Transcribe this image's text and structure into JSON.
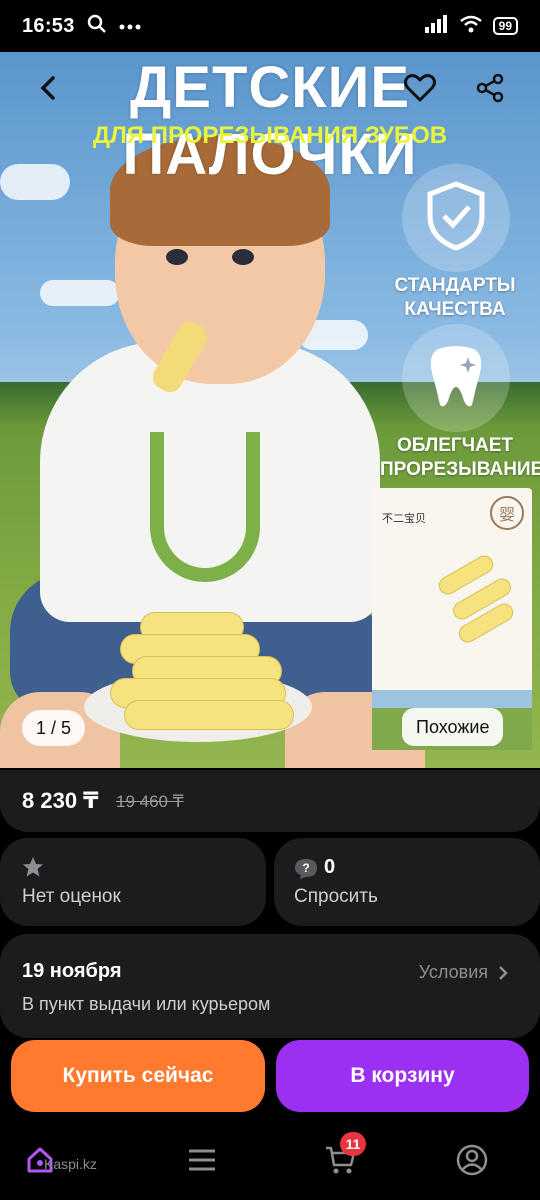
{
  "status_bar": {
    "time": "16:53",
    "battery": "99"
  },
  "hero": {
    "title": "ДЕТСКИЕ ПАЛОЧКИ",
    "subtitle": "ДЛЯ ПРОРЕЗЫВАНИЯ ЗУБОВ",
    "badge_quality": "СТАНДАРТЫ КАЧЕСТВА",
    "badge_teething": "ОБЛЕГЧАЕТ ПРОРЕЗЫВАНИЕ",
    "box_brand": "不二宝贝",
    "box_seal": "婴",
    "image_counter": "1 / 5",
    "similar_label": "Похожие"
  },
  "price": {
    "current": "8 230 ₸",
    "old": "19 460 ₸"
  },
  "rating": {
    "label": "Нет оценок"
  },
  "questions": {
    "count": "0",
    "label": "Спросить"
  },
  "delivery": {
    "date": "19 ноября",
    "terms_label": "Условия",
    "method": "В пункт выдачи или курьером"
  },
  "actions": {
    "buy_now": "Купить сейчас",
    "add_to_cart": "В корзину"
  },
  "bottom_nav": {
    "brand": "Kaspi.kz",
    "cart_count": "11"
  },
  "colors": {
    "buy": "#ff7a2e",
    "cart": "#9b30f2",
    "badge": "#e8343f",
    "subtitle": "#e9f43a"
  }
}
